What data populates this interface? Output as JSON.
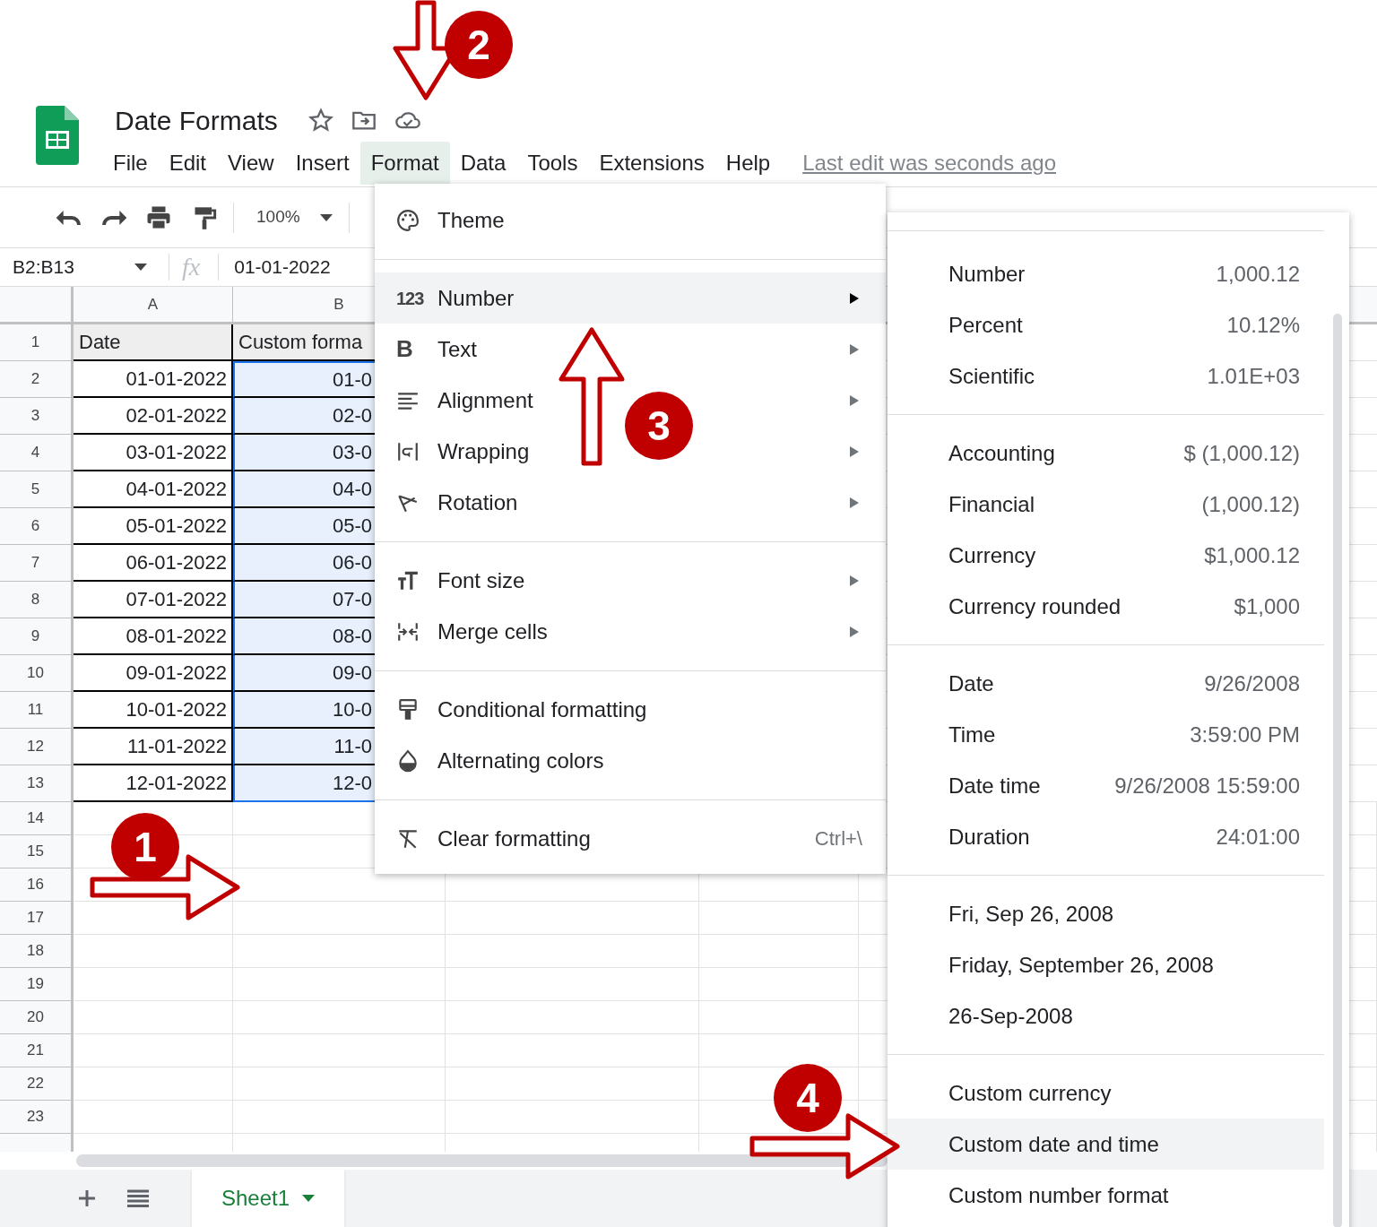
{
  "app": {
    "title": "Date Formats",
    "last_edit": "Last edit was seconds ago",
    "menus": [
      {
        "label": "File",
        "selected": false
      },
      {
        "label": "Edit",
        "selected": false
      },
      {
        "label": "View",
        "selected": false
      },
      {
        "label": "Insert",
        "selected": false
      },
      {
        "label": "Format",
        "selected": true
      },
      {
        "label": "Data",
        "selected": false
      },
      {
        "label": "Tools",
        "selected": false
      },
      {
        "label": "Extensions",
        "selected": false
      },
      {
        "label": "Help",
        "selected": false
      }
    ]
  },
  "toolbar": {
    "zoom": "100%"
  },
  "formula_bar": {
    "name_box": "B2:B13",
    "fx": "fx",
    "value": "01-01-2022"
  },
  "grid": {
    "columns": [
      "A",
      "B"
    ],
    "rows": [
      {
        "number": "1",
        "kind": "header",
        "cells": [
          {
            "text": "Date",
            "selected": false
          },
          {
            "text": "Custom forma",
            "selected": false
          }
        ]
      },
      {
        "number": "2",
        "kind": "data",
        "cells": [
          {
            "text": "01-01-2022",
            "selected": false
          },
          {
            "text": "01-0",
            "selected": true
          }
        ]
      },
      {
        "number": "3",
        "kind": "data",
        "cells": [
          {
            "text": "02-01-2022",
            "selected": false
          },
          {
            "text": "02-0",
            "selected": true
          }
        ]
      },
      {
        "number": "4",
        "kind": "data",
        "cells": [
          {
            "text": "03-01-2022",
            "selected": false
          },
          {
            "text": "03-0",
            "selected": true
          }
        ]
      },
      {
        "number": "5",
        "kind": "data",
        "cells": [
          {
            "text": "04-01-2022",
            "selected": false
          },
          {
            "text": "04-0",
            "selected": true
          }
        ]
      },
      {
        "number": "6",
        "kind": "data",
        "cells": [
          {
            "text": "05-01-2022",
            "selected": false
          },
          {
            "text": "05-0",
            "selected": true
          }
        ]
      },
      {
        "number": "7",
        "kind": "data",
        "cells": [
          {
            "text": "06-01-2022",
            "selected": false
          },
          {
            "text": "06-0",
            "selected": true
          }
        ]
      },
      {
        "number": "8",
        "kind": "data",
        "cells": [
          {
            "text": "07-01-2022",
            "selected": false
          },
          {
            "text": "07-0",
            "selected": true
          }
        ]
      },
      {
        "number": "9",
        "kind": "data",
        "cells": [
          {
            "text": "08-01-2022",
            "selected": false
          },
          {
            "text": "08-0",
            "selected": true
          }
        ]
      },
      {
        "number": "10",
        "kind": "data",
        "cells": [
          {
            "text": "09-01-2022",
            "selected": false
          },
          {
            "text": "09-0",
            "selected": true
          }
        ]
      },
      {
        "number": "11",
        "kind": "data",
        "cells": [
          {
            "text": "10-01-2022",
            "selected": false
          },
          {
            "text": "10-0",
            "selected": true
          }
        ]
      },
      {
        "number": "12",
        "kind": "data",
        "cells": [
          {
            "text": "11-01-2022",
            "selected": false
          },
          {
            "text": "11-0",
            "selected": true
          }
        ]
      },
      {
        "number": "13",
        "kind": "data",
        "cells": [
          {
            "text": "12-01-2022",
            "selected": false
          },
          {
            "text": "12-0",
            "selected": true
          }
        ]
      }
    ],
    "empty_rows": [
      "14",
      "15",
      "16",
      "17",
      "18",
      "19",
      "20",
      "21",
      "22",
      "23"
    ]
  },
  "format_menu": {
    "groups": [
      [
        {
          "label": "Theme",
          "submenu": false,
          "selected": false
        }
      ],
      [
        {
          "label": "Number",
          "icon_text": "123",
          "submenu": true,
          "selected": true
        },
        {
          "label": "Text",
          "icon_text": "B",
          "submenu": true,
          "selected": false
        },
        {
          "label": "Alignment",
          "submenu": true,
          "selected": false
        },
        {
          "label": "Wrapping",
          "submenu": true,
          "selected": false
        },
        {
          "label": "Rotation",
          "submenu": true,
          "selected": false
        }
      ],
      [
        {
          "label": "Font size",
          "submenu": true,
          "selected": false
        },
        {
          "label": "Merge cells",
          "submenu": true,
          "selected": false
        }
      ],
      [
        {
          "label": "Conditional formatting",
          "submenu": false,
          "selected": false
        },
        {
          "label": "Alternating colors",
          "submenu": false,
          "selected": false
        }
      ],
      [
        {
          "label": "Clear formatting",
          "shortcut": "Ctrl+\\",
          "submenu": false,
          "selected": false
        }
      ]
    ]
  },
  "number_submenu": {
    "groups": [
      [
        {
          "label": "Number",
          "example": "1,000.12",
          "selected": false
        },
        {
          "label": "Percent",
          "example": "10.12%",
          "selected": false
        },
        {
          "label": "Scientific",
          "example": "1.01E+03",
          "selected": false
        }
      ],
      [
        {
          "label": "Accounting",
          "example": "$ (1,000.12)",
          "selected": false
        },
        {
          "label": "Financial",
          "example": "(1,000.12)",
          "selected": false
        },
        {
          "label": "Currency",
          "example": "$1,000.12",
          "selected": false
        },
        {
          "label": "Currency rounded",
          "example": "$1,000",
          "selected": false
        }
      ],
      [
        {
          "label": "Date",
          "example": "9/26/2008",
          "selected": false
        },
        {
          "label": "Time",
          "example": "3:59:00 PM",
          "selected": false
        },
        {
          "label": "Date time",
          "example": "9/26/2008 15:59:00",
          "selected": false
        },
        {
          "label": "Duration",
          "example": "24:01:00",
          "selected": false
        }
      ],
      [
        {
          "label": "Fri, Sep 26, 2008",
          "selected": false
        },
        {
          "label": "Friday, September 26, 2008",
          "selected": false
        },
        {
          "label": "26-Sep-2008",
          "selected": false
        }
      ],
      [
        {
          "label": "Custom currency",
          "selected": false
        },
        {
          "label": "Custom date and time",
          "selected": true
        },
        {
          "label": "Custom number format",
          "selected": false
        }
      ]
    ]
  },
  "sheet_tabs": [
    {
      "label": "Sheet1",
      "selected": true
    }
  ],
  "annotations": [
    {
      "label": "2",
      "kind": "down"
    },
    {
      "label": "1",
      "kind": "right"
    },
    {
      "label": "3",
      "kind": "up"
    },
    {
      "label": "4",
      "kind": "right"
    }
  ]
}
